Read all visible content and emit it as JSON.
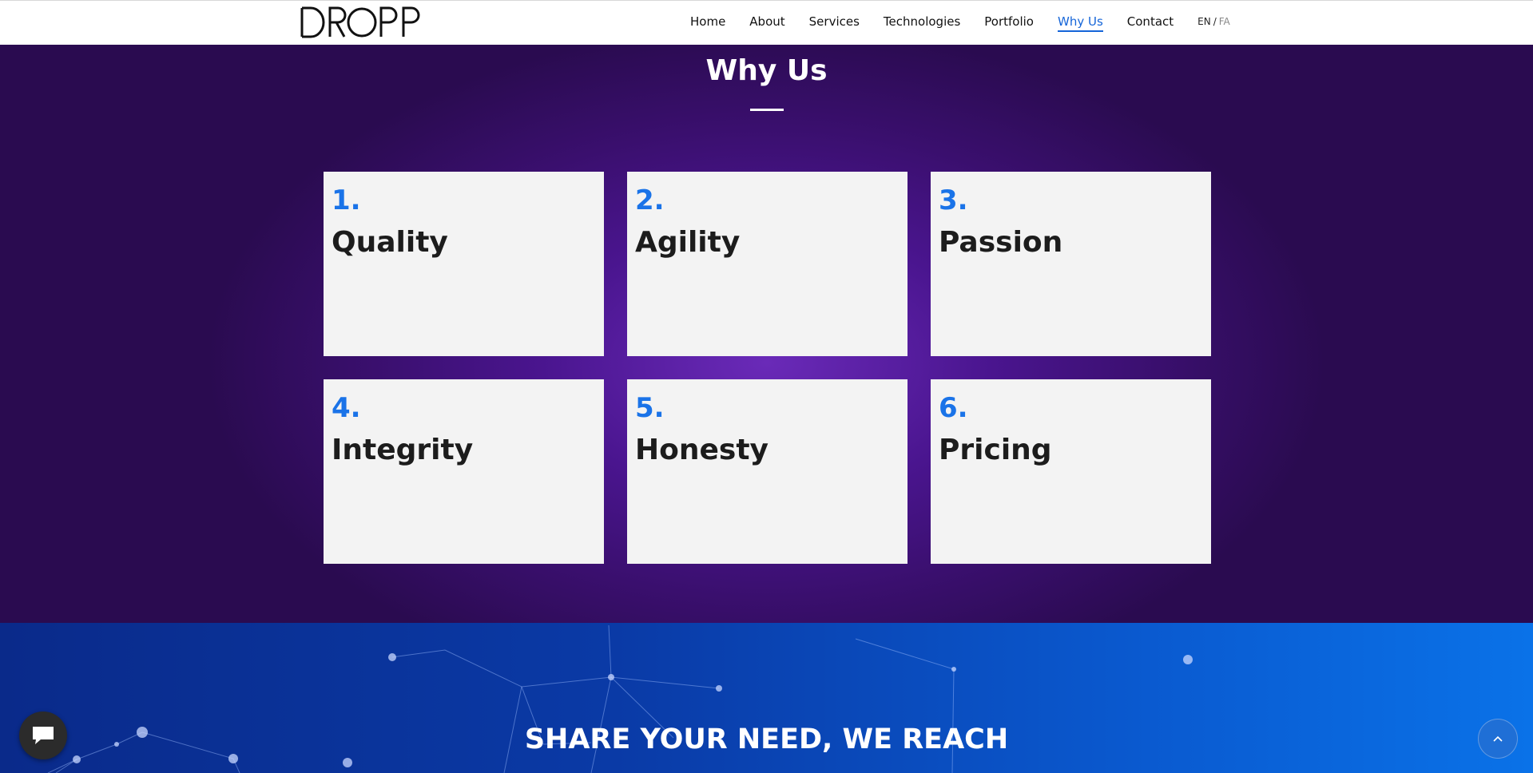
{
  "header": {
    "logo_alt": "DROPP",
    "nav": [
      {
        "label": "Home"
      },
      {
        "label": "About"
      },
      {
        "label": "Services"
      },
      {
        "label": "Technologies"
      },
      {
        "label": "Portfolio"
      },
      {
        "label": "Why Us",
        "active": true
      },
      {
        "label": "Contact"
      }
    ],
    "lang": {
      "en": "EN",
      "separator": "/",
      "fa": "FA"
    }
  },
  "why": {
    "title": "Why Us",
    "cards": [
      {
        "number": "1.",
        "title": "Quality"
      },
      {
        "number": "2.",
        "title": "Agility"
      },
      {
        "number": "3.",
        "title": "Passion"
      },
      {
        "number": "4.",
        "title": "Integrity"
      },
      {
        "number": "5.",
        "title": "Honesty"
      },
      {
        "number": "6.",
        "title": "Pricing"
      }
    ]
  },
  "share": {
    "title": "SHARE YOUR NEED, WE REACH"
  },
  "colors": {
    "accent": "#1a73e8",
    "nav_active": "#1565d8",
    "why_bg": "#3a0f6e",
    "card_bg": "#f3f3f3",
    "share_bg_start": "#0a2a8a",
    "share_bg_end": "#0a72e8"
  },
  "icons": {
    "chat": "chat-bubble-icon",
    "back_to_top": "chevron-up-icon"
  }
}
